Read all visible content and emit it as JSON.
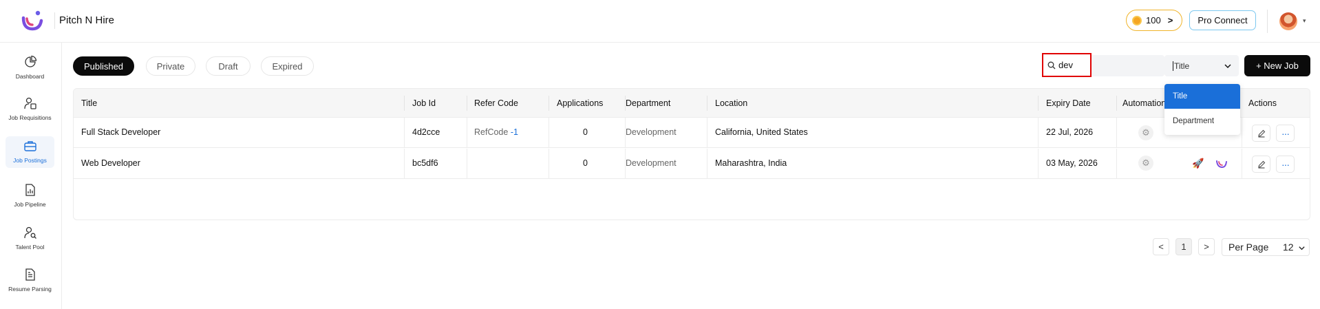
{
  "app": {
    "brand": "Pitch N Hire"
  },
  "header": {
    "coins": "100",
    "coins_chevron": ">",
    "pro_connect": "Pro Connect",
    "avatar_caret": "▾"
  },
  "sidebar": {
    "items": [
      {
        "label": "Dashboard",
        "icon": "pie-chart-icon"
      },
      {
        "label": "Job Requisitions",
        "icon": "user-file-icon"
      },
      {
        "label": "Job Postings",
        "icon": "briefcase-icon",
        "active": true
      },
      {
        "label": "Job Pipeline",
        "icon": "chart-file-icon"
      },
      {
        "label": "Talent Pool",
        "icon": "user-search-icon"
      },
      {
        "label": "Resume Parsing",
        "icon": "document-icon"
      }
    ]
  },
  "tabs": [
    {
      "label": "Published",
      "active": true
    },
    {
      "label": "Private"
    },
    {
      "label": "Draft"
    },
    {
      "label": "Expired"
    }
  ],
  "search": {
    "value": "dev"
  },
  "filter": {
    "selected": "Title",
    "options": [
      "Title",
      "Department"
    ]
  },
  "new_job": "+ New Job",
  "table": {
    "headers": [
      "Title",
      "Job Id",
      "Refer Code",
      "Applications",
      "Department",
      "Location",
      "Expiry Date",
      "Automation",
      "Actions"
    ],
    "rows": [
      {
        "title": "Full Stack Developer",
        "job_id": "4d2cce",
        "refer_code": "RefCode",
        "refer_num": "-1",
        "applications": "0",
        "department": "Development",
        "location": "California, United States",
        "expiry": "22 Jul, 2026"
      },
      {
        "title": "Web Developer",
        "job_id": "bc5df6",
        "refer_code": "",
        "refer_num": "",
        "applications": "0",
        "department": "Development",
        "location": "Maharashtra, India",
        "expiry": "03 May, 2026"
      }
    ]
  },
  "pagination": {
    "prev": "<",
    "page": "1",
    "next": ">",
    "per_page_label": "Per Page",
    "per_page_value": "12"
  },
  "colors": {
    "accent": "#1a6fd9",
    "primary_button": "#0b0b0b",
    "highlight_border": "#e00000",
    "coin": "#f5a623"
  }
}
